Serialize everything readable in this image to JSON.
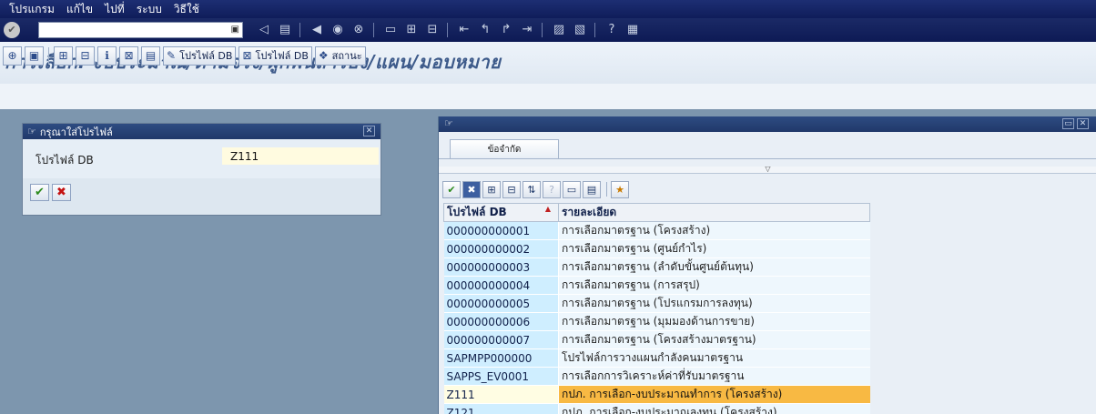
{
  "menu": {
    "items": [
      "โปรแกรม",
      "แก้ไข",
      "ไปที่",
      "ระบบ",
      "วิธีใช้"
    ]
  },
  "standard_toolbar": {
    "command_field_value": "",
    "icons": [
      "enter-icon",
      "save-icon",
      "back-icon",
      "exit-icon",
      "cancel-icon",
      "print-icon",
      "find-icon",
      "find-next-icon",
      "first-page-icon",
      "prev-page-icon",
      "next-page-icon",
      "last-page-icon",
      "new-session-icon",
      "shortcut-icon",
      "help-icon",
      "layout-icon"
    ]
  },
  "page_title": "การเลือก: งบประมาณ/ตามจริง/ผูกพันสำรอง/แผน/มอบหมาย",
  "app_toolbar": {
    "db_profile_label_1": "โปรไฟล์ DB",
    "db_profile_label_2": "โปรไฟล์ DB",
    "status_label": "สถานะ"
  },
  "dialog": {
    "title": "กรุณาใส่โปรไฟล์",
    "field_label": "โปรไฟล์ DB",
    "field_value": "Z111"
  },
  "popup": {
    "tab_label": "ข้อจำกัด",
    "table": {
      "columns": [
        "โปรไฟล์ DB",
        "รายละเอียด"
      ],
      "rows": [
        {
          "key": "000000000001",
          "desc": "การเลือกมาตรฐาน (โครงสร้าง)"
        },
        {
          "key": "000000000002",
          "desc": "การเลือกมาตรฐาน (ศูนย์กำไร)"
        },
        {
          "key": "000000000003",
          "desc": "การเลือกมาตรฐาน (ลำดับขั้นศูนย์ต้นทุน)"
        },
        {
          "key": "000000000004",
          "desc": "การเลือกมาตรฐาน (การสรุป)"
        },
        {
          "key": "000000000005",
          "desc": "การเลือกมาตรฐาน (โปรแกรมการลงทุน)"
        },
        {
          "key": "000000000006",
          "desc": "การเลือกมาตรฐาน (มุมมองด้านการขาย)"
        },
        {
          "key": "000000000007",
          "desc": "การเลือกมาตรฐาน (โครงสร้างมาตรฐาน)"
        },
        {
          "key": "SAPMPP000000",
          "desc": "โปรไฟล์การวางแผนกำลังคนมาตรฐาน"
        },
        {
          "key": "SAPPS_EV0001",
          "desc": "การเลือกการวิเคราะห์ค่าที่รับมาตรฐาน"
        },
        {
          "key": "Z111",
          "desc": "กปภ. การเลือก-งบประมาณทำการ (โครงสร้าง)",
          "selected": true
        },
        {
          "key": "Z121",
          "desc": "กปภ. การเลือก-งบประมาณลงทุน (โครงสร้าง)"
        }
      ]
    }
  },
  "colors": {
    "menubar": "#1d2e73",
    "title_text": "#3d5a8a",
    "main_background": "#7d96ae",
    "selected_row": "#f8b943",
    "key_cell": "#cfeeff"
  }
}
